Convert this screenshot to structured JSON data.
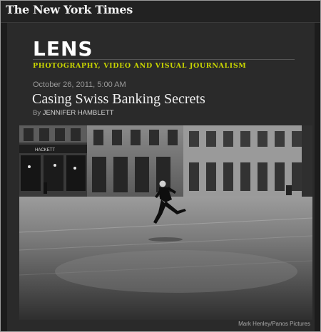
{
  "header": {
    "logo_text": "The New York Times"
  },
  "blog": {
    "name": "LENS",
    "tagline": "PHOTOGRAPHY, VIDEO AND VISUAL JOURNALISM"
  },
  "post": {
    "date": "October 26, 2011, 5:00 AM",
    "title": "Casing Swiss Banking Secrets",
    "by_label": "By",
    "author": "JENNIFER HAMBLETT"
  },
  "photo": {
    "storefront_sign": "HACKETT",
    "credit": "Mark Henley/Panos Pictures"
  },
  "colors": {
    "background": "#1c1c1c",
    "panel": "#2a2a2a",
    "tagline": "#c8d400"
  }
}
